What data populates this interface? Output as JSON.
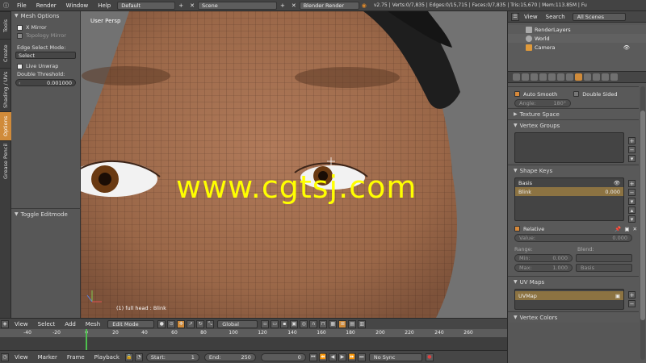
{
  "topbar": {
    "menus": [
      "File",
      "Render",
      "Window",
      "Help"
    ],
    "layout": "Default",
    "scene": "Scene",
    "engine": "Blender Render",
    "stats": "v2.75 | Verts:0/7,835 | Edges:0/15,715 | Faces:0/7,835 | Tris:15,670 | Mem:113.85M | Fu"
  },
  "tool_tabs": [
    "Tools",
    "Create",
    "Shading / UVs",
    "Options",
    "Grease Pencil"
  ],
  "tool_panel": {
    "title": "Mesh Options",
    "x_mirror": "X Mirror",
    "topology_mirror": "Topology Mirror",
    "edge_select_mode_label": "Edge Select Mode:",
    "edge_select_mode_value": "Select",
    "live_unwrap": "Live Unwrap",
    "double_threshold_label": "Double Threshold:",
    "double_threshold_value": "0.001000",
    "toggle_editmode": "Toggle Editmode"
  },
  "viewport": {
    "label": "User Persp",
    "object": "(1) full head : Blink",
    "watermark": "www.cgtsj.com"
  },
  "header": {
    "view": "View",
    "select": "Select",
    "add": "Add",
    "mesh": "Mesh",
    "mode": "Edit Mode",
    "orientation": "Global"
  },
  "timeline": {
    "ticks": [
      "-40",
      "-20",
      "0",
      "20",
      "40",
      "60",
      "80",
      "100",
      "120",
      "140",
      "160",
      "180",
      "200",
      "220",
      "240",
      "260"
    ],
    "view": "View",
    "marker": "Marker",
    "frame": "Frame",
    "playback": "Playback",
    "start_label": "Start:",
    "start_value": "1",
    "end_label": "End:",
    "end_value": "250",
    "current": "0",
    "sync": "No Sync"
  },
  "outliner": {
    "view": "View",
    "search": "Search",
    "scenes": "All Scenes",
    "items": [
      "RenderLayers",
      "World",
      "Camera"
    ]
  },
  "properties": {
    "auto_smooth": "Auto Smooth",
    "double_sided": "Double Sided",
    "angle_label": "Angle:",
    "angle_value": "180°",
    "texture_space": "Texture Space",
    "vertex_groups": "Vertex Groups",
    "shape_keys": "Shape Keys",
    "key_basis": "Basis",
    "key_blink": "Blink",
    "key_blink_value": "0.000",
    "relative": "Relative",
    "value_label": "Value:",
    "value_value": "0.000",
    "range_label": "Range:",
    "blend_label": "Blend:",
    "min_label": "Min:",
    "min_value": "0.000",
    "max_label": "Max:",
    "max_value": "1.000",
    "blend_value": "Basis",
    "uv_maps": "UV Maps",
    "uv_map_name": "UVMap",
    "vertex_colors": "Vertex Colors"
  }
}
